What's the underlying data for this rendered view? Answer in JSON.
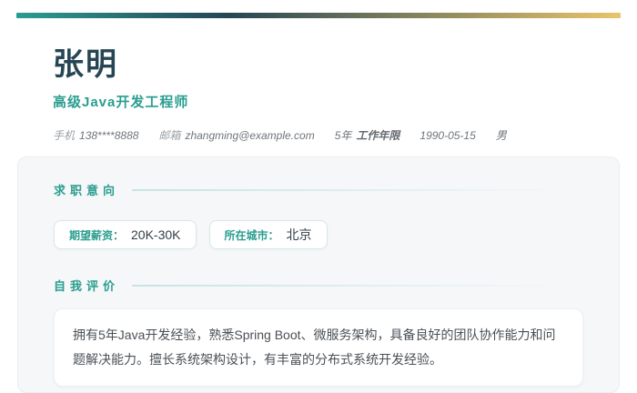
{
  "theme": {
    "teal": "#2a9d8f",
    "dark_slate": "#264653",
    "gold": "#e9c46a",
    "card_bg": "#f5f7f9"
  },
  "header": {
    "name": "张明",
    "job_title": "高级Java开发工程师",
    "contact": {
      "phone_label": "手机",
      "phone_value": "138****8888",
      "email_label": "邮箱",
      "email_value": "zhangming@example.com",
      "experience_value": "5年",
      "experience_label": "工作年限",
      "birth_date": "1990-05-15",
      "gender": "男"
    }
  },
  "sections": {
    "job_intention": {
      "title": "求职意向",
      "pills": [
        {
          "label": "期望薪资：",
          "value": "20K-30K"
        },
        {
          "label": "所在城市：",
          "value": "北京"
        }
      ]
    },
    "self_evaluation": {
      "title": "自我评价",
      "content": "拥有5年Java开发经验，熟悉Spring Boot、微服务架构，具备良好的团队协作能力和问题解决能力。擅长系统架构设计，有丰富的分布式系统开发经验。"
    }
  }
}
